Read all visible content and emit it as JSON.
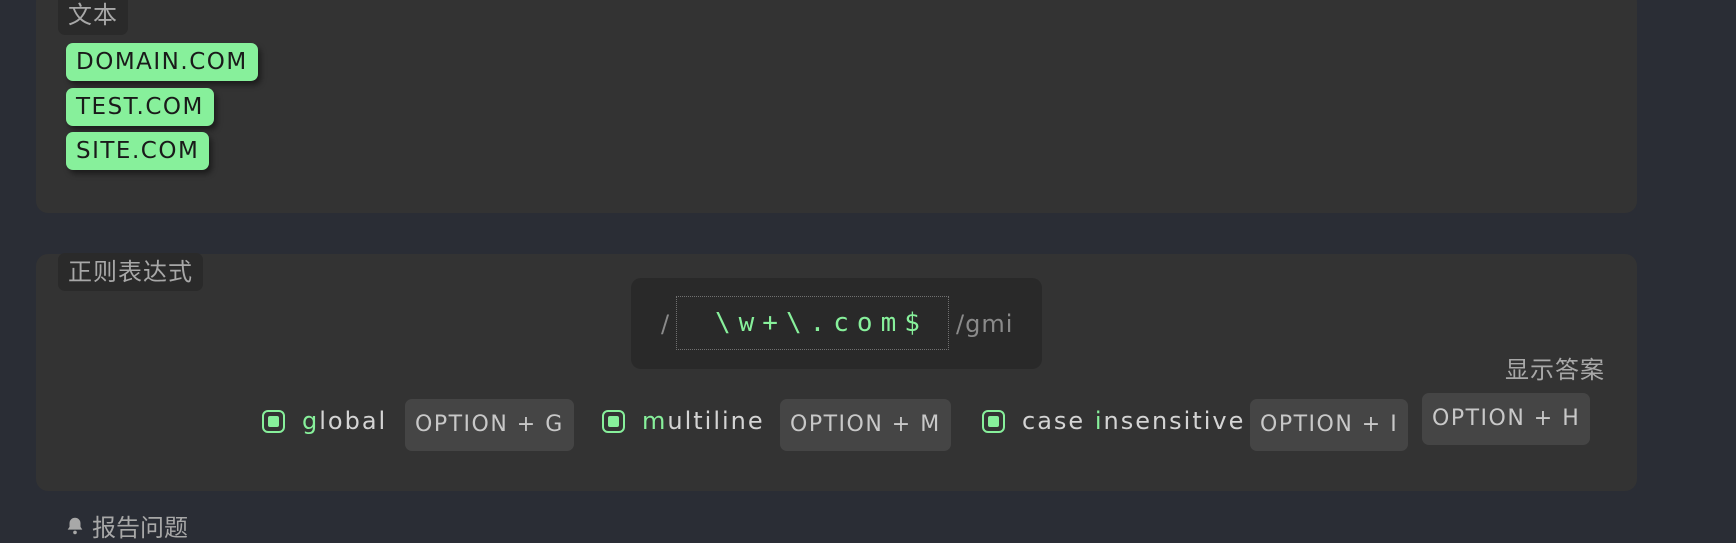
{
  "text_section": {
    "label": "文本",
    "matches": [
      "DOMAIN.COM",
      "TEST.COM",
      "SITE.COM"
    ]
  },
  "regex_section": {
    "label": "正则表达式",
    "open_slash": "/",
    "pattern": "\\w+\\.com$",
    "flags_suffix": "/gmi",
    "show_answer": "显示答案",
    "flags": [
      {
        "key_letter": "g",
        "rest": "lobal",
        "prefix": "",
        "shortcut": "OPTION + G"
      },
      {
        "key_letter": "m",
        "rest": "ultiline",
        "prefix": "",
        "shortcut": "OPTION + M"
      },
      {
        "key_letter": "i",
        "rest": "nsensitive",
        "prefix": "case ",
        "shortcut": "OPTION + I"
      }
    ],
    "hint_shortcut": "OPTION + H"
  },
  "footer": {
    "report_label": "报告问题"
  },
  "colors": {
    "accent": "#87f09b",
    "background": "#2a2d35",
    "panel": "#333333"
  }
}
